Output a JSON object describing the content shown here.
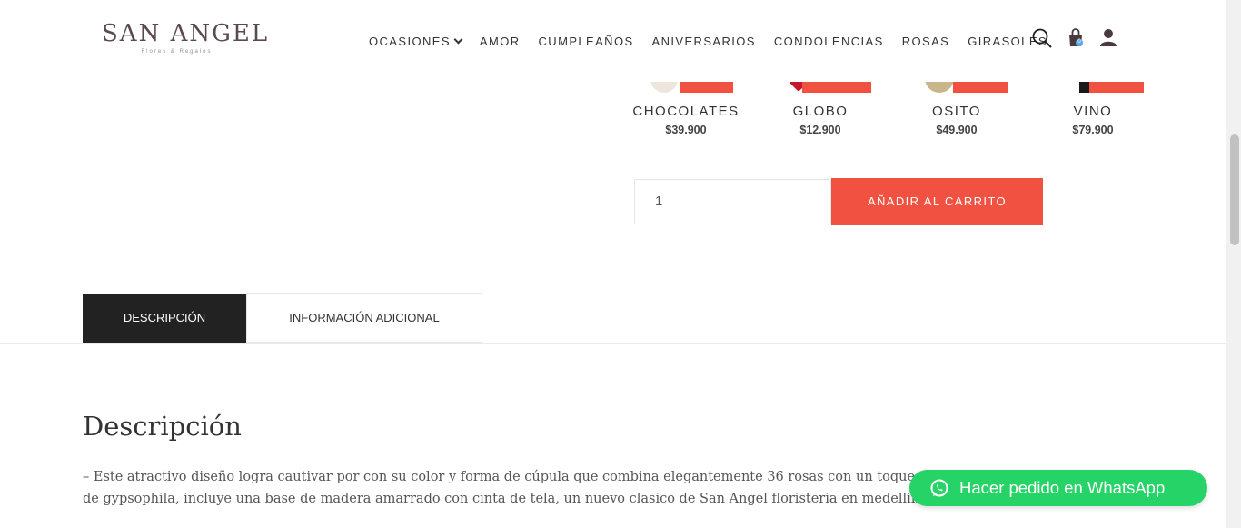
{
  "brand": {
    "name": "SAN ANGEL",
    "tagline": "Flores & Regalos"
  },
  "nav": {
    "items": [
      "OCASIONES",
      "AMOR",
      "CUMPLEAÑOS",
      "ANIVERSARIOS",
      "CONDOLENCIAS",
      "ROSAS",
      "GIRASOLES"
    ],
    "cart_count": "0"
  },
  "addons": [
    {
      "name": "CHOCOLATES",
      "price": "$39.900"
    },
    {
      "name": "GLOBO",
      "price": "$12.900"
    },
    {
      "name": "OSITO",
      "price": "$49.900"
    },
    {
      "name": "VINO",
      "price": "$79.900"
    }
  ],
  "purchase": {
    "quantity": "1",
    "add_to_cart": "AÑADIR AL CARRITO"
  },
  "tabs": {
    "description": "DESCRIPCIÓN",
    "additional": "INFORMACIÓN ADICIONAL"
  },
  "description": {
    "title": "Descripción",
    "text": "– Este atractivo diseño logra cautivar por con su color y forma de cúpula que combina elegantemente 36 rosas con un toque de gypsophila, incluye una base de madera amarrado con cinta de tela, un nuevo clasico de San Angel floristeria en medellin"
  },
  "whatsapp": {
    "label": "Hacer pedido en WhatsApp"
  },
  "colors": {
    "accent": "#f15140",
    "dark_tab": "#222222",
    "whatsapp": "#25d366"
  }
}
